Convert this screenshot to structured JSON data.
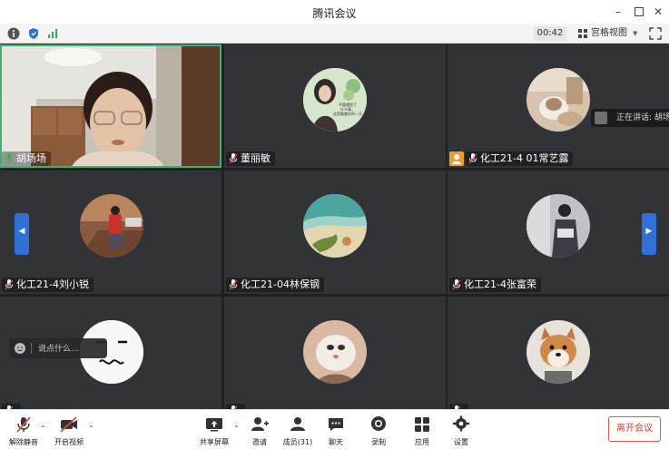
{
  "window": {
    "title": "腾讯会议"
  },
  "statusbar": {
    "timer": "00:42",
    "view_label": "宫格视图"
  },
  "participants": [
    {
      "name": "胡场场"
    },
    {
      "name": "董丽敏"
    },
    {
      "name": "化工21-4 01常艺露"
    },
    {
      "name": "化工21-4刘小锐"
    },
    {
      "name": "化工21-04林保钢"
    },
    {
      "name": "化工21-4张富荣"
    },
    {
      "name": ""
    },
    {
      "name": ""
    },
    {
      "name": ""
    }
  ],
  "avatar_caption": "不管遇到了\n什么事，\n这是最美好的一天",
  "speaking": {
    "label": "正在讲话: 胡场"
  },
  "chat": {
    "placeholder": "说点什么..."
  },
  "toolbar": {
    "mute_label": "解除静音",
    "video_label": "开启视频",
    "share_label": "共享屏幕",
    "invite_label": "邀请",
    "members_label": "成员(31)",
    "chat_label": "聊天",
    "record_label": "录制",
    "apps_label": "应用",
    "settings_label": "设置",
    "leave_label": "离开会议"
  },
  "colors": {
    "accent": "#2f6fd8",
    "leave": "#d83b2f",
    "active_border": "#3cb371"
  }
}
